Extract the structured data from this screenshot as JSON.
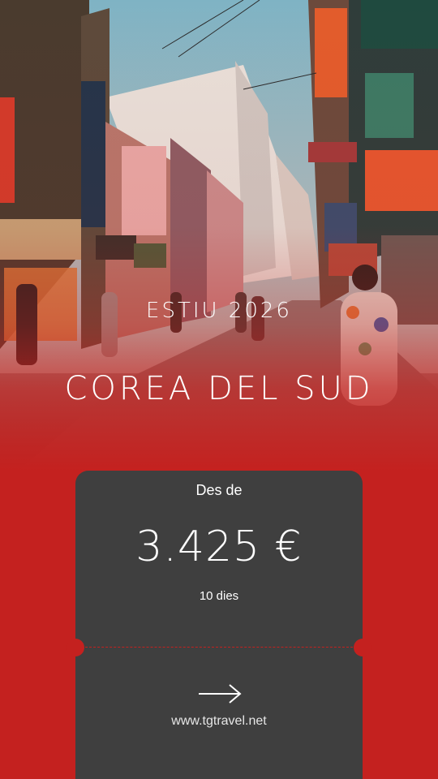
{
  "hero": {
    "image_description_icon": "street-scene-photo",
    "accent_color": "#c4211f"
  },
  "headline": {
    "season": "ESTIU 2026",
    "destination": "COREA DEL SUD"
  },
  "ticket": {
    "from_label": "Des de",
    "price": "3.425 €",
    "duration": "10 dies",
    "arrow_icon": "arrow-right-icon",
    "website": "www.tgtravel.net",
    "background_color": "#3f3f3f"
  }
}
